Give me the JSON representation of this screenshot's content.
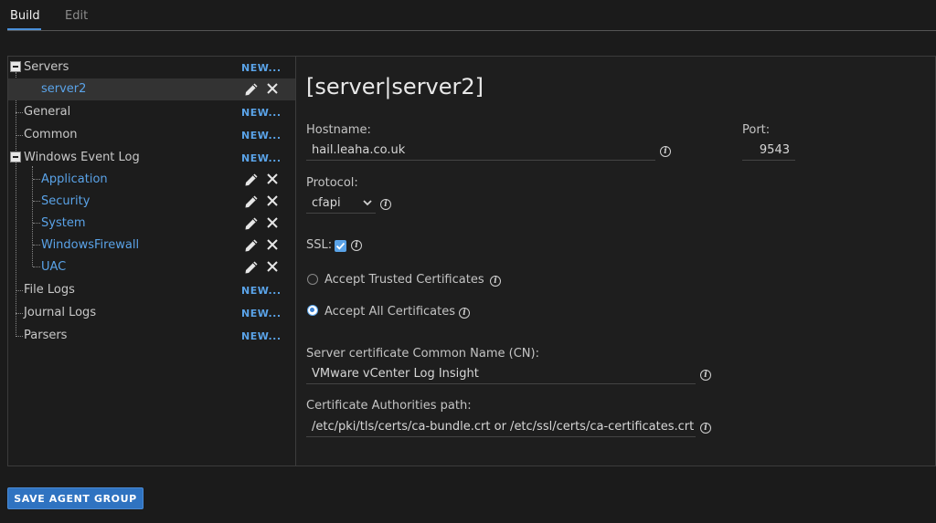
{
  "tabs": [
    {
      "label": "Build",
      "active": true
    },
    {
      "label": "Edit",
      "active": false
    }
  ],
  "tree": {
    "new_label": "NEW...",
    "items": [
      {
        "label": "Servers"
      },
      {
        "label": "server2"
      },
      {
        "label": "General"
      },
      {
        "label": "Common"
      },
      {
        "label": "Windows Event Log"
      },
      {
        "label": "Application"
      },
      {
        "label": "Security"
      },
      {
        "label": "System"
      },
      {
        "label": "WindowsFirewall"
      },
      {
        "label": "UAC"
      },
      {
        "label": "File Logs"
      },
      {
        "label": "Journal Logs"
      },
      {
        "label": "Parsers"
      }
    ]
  },
  "form": {
    "title": "[server|server2]",
    "hostname_label": "Hostname:",
    "hostname_value": "hail.leaha.co.uk",
    "port_label": "Port:",
    "port_value": "9543",
    "protocol_label": "Protocol:",
    "protocol_value": "cfapi",
    "ssl_label": "SSL:",
    "ssl_checked": true,
    "radio_trusted": "Accept Trusted Certificates",
    "radio_all": "Accept All Certificates",
    "selected_radio": "all",
    "cn_label": "Server certificate Common Name (CN):",
    "cn_value": "VMware vCenter Log Insight",
    "ca_label": "Certificate Authorities path:",
    "ca_value": "/etc/pki/tls/certs/ca-bundle.crt or /etc/ssl/certs/ca-certificates.crt"
  },
  "save_button": "SAVE AGENT GROUP",
  "colors": {
    "accent": "#4a90d9",
    "link": "#5aa3e8",
    "button": "#2f73c1"
  }
}
